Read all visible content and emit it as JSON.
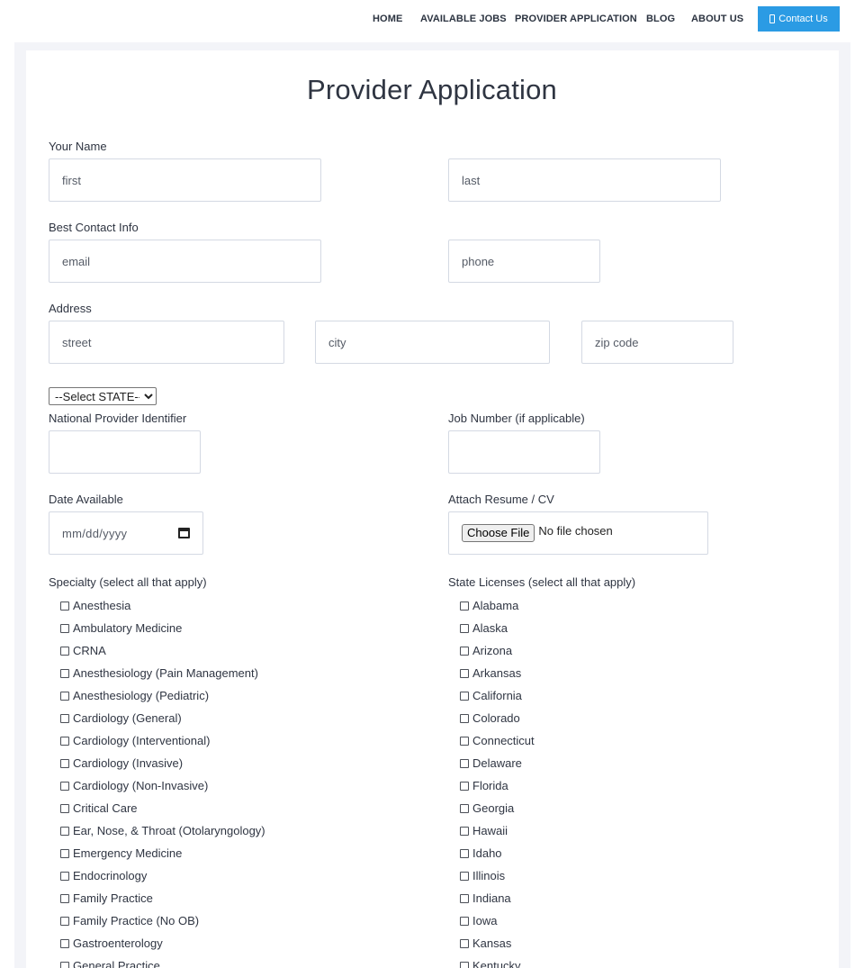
{
  "nav": {
    "items": [
      "HOME",
      "AVAILABLE JOBS",
      "PROVIDER APPLICATION",
      "BLOG",
      "ABOUT US"
    ],
    "contact_label": "Contact Us",
    "contact_color": "#2b9be4"
  },
  "page_title": "Provider Application",
  "form": {
    "name_label": "Your Name",
    "first_placeholder": "first",
    "last_placeholder": "last",
    "contact_label": "Best Contact Info",
    "email_placeholder": "email",
    "phone_placeholder": "phone",
    "address_label": "Address",
    "street_placeholder": "street",
    "city_placeholder": "city",
    "zip_placeholder": "zip code",
    "state_select_value": "--Select STATE--",
    "npi_label": "National Provider Identifier",
    "job_label": "Job Number (if applicable)",
    "date_label": "Date Available",
    "date_placeholder": "mm/dd/yyyy",
    "resume_label": "Attach Resume / CV",
    "file_button": "Choose File",
    "file_status": "No file chosen",
    "specialty_label": "Specialty (select all that apply)",
    "licenses_label": "State Licenses (select all that apply)"
  },
  "specialties": [
    "Anesthesia",
    "Ambulatory Medicine",
    "CRNA",
    "Anesthesiology (Pain Management)",
    "Anesthesiology (Pediatric)",
    "Cardiology (General)",
    "Cardiology (Interventional)",
    "Cardiology (Invasive)",
    "Cardiology (Non-Invasive)",
    "Critical Care",
    "Ear, Nose, & Throat (Otolaryngology)",
    "Emergency Medicine",
    "Endocrinology",
    "Family Practice",
    "Family Practice (No OB)",
    "Gastroenterology",
    "General Practice"
  ],
  "states": [
    "Alabama",
    "Alaska",
    "Arizona",
    "Arkansas",
    "California",
    "Colorado",
    "Connecticut",
    "Delaware",
    "Florida",
    "Georgia",
    "Hawaii",
    "Idaho",
    "Illinois",
    "Indiana",
    "Iowa",
    "Kansas",
    "Kentucky"
  ]
}
